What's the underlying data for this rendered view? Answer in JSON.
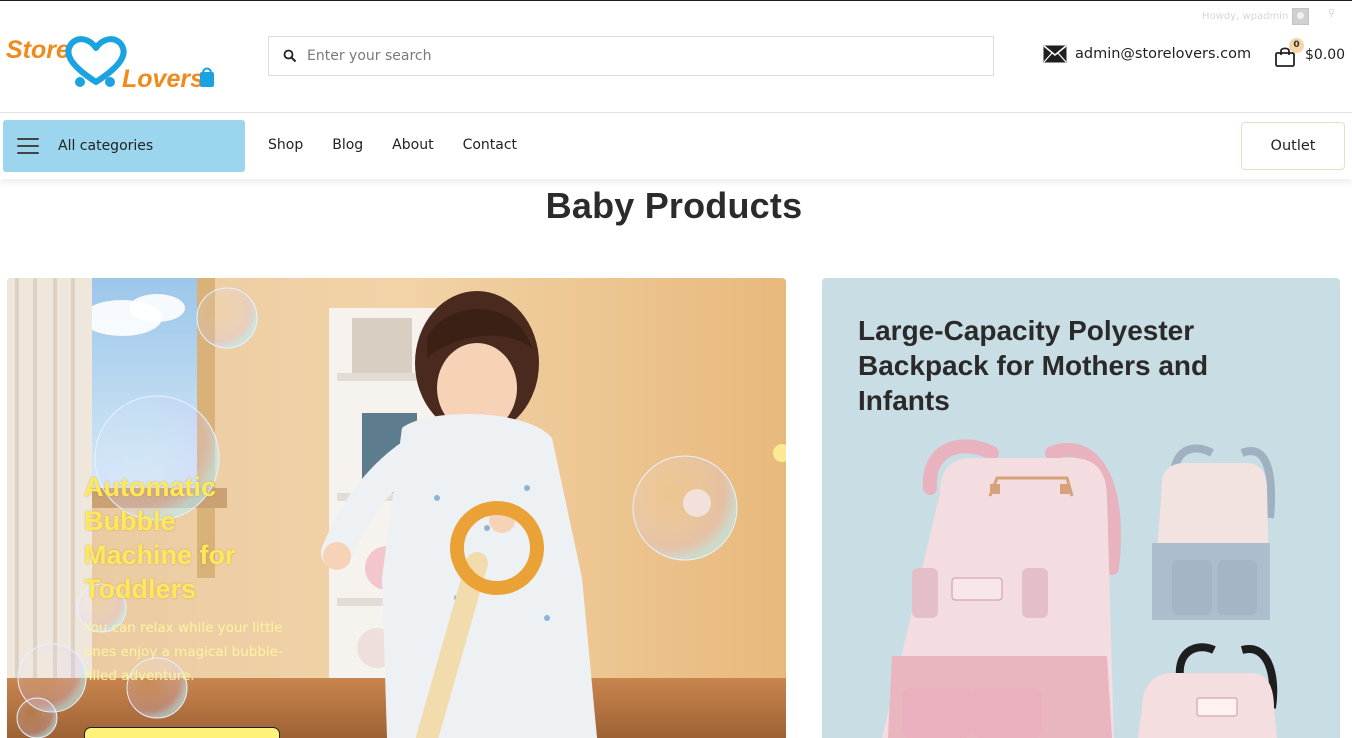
{
  "admin_bar": {
    "howdy": "Howdy, wpadmin"
  },
  "header": {
    "logo": {
      "word1": "Store",
      "word2": "Lovers"
    },
    "search": {
      "placeholder": "Enter your search"
    },
    "email": "admin@storelovers.com",
    "cart": {
      "count": "0",
      "total": "$0.00"
    }
  },
  "nav": {
    "all_categories": "All categories",
    "links": [
      "Shop",
      "Blog",
      "About",
      "Contact"
    ],
    "outlet": "Outlet"
  },
  "section": {
    "title": "Baby Products"
  },
  "cards": [
    {
      "title": "Automatic Bubble Machine for Toddlers",
      "description": "You can relax while your little ones enjoy a magical bubble-filled adventure."
    },
    {
      "title": "Large-Capacity Polyester Backpack for Mothers and Infants",
      "background": "#c8dde4"
    }
  ],
  "colors": {
    "accent_blue": "#9cd6ee",
    "logo_orange": "#f08a1c",
    "logo_blue": "#1aa3e0",
    "promo_yellow": "#ffe95a"
  }
}
